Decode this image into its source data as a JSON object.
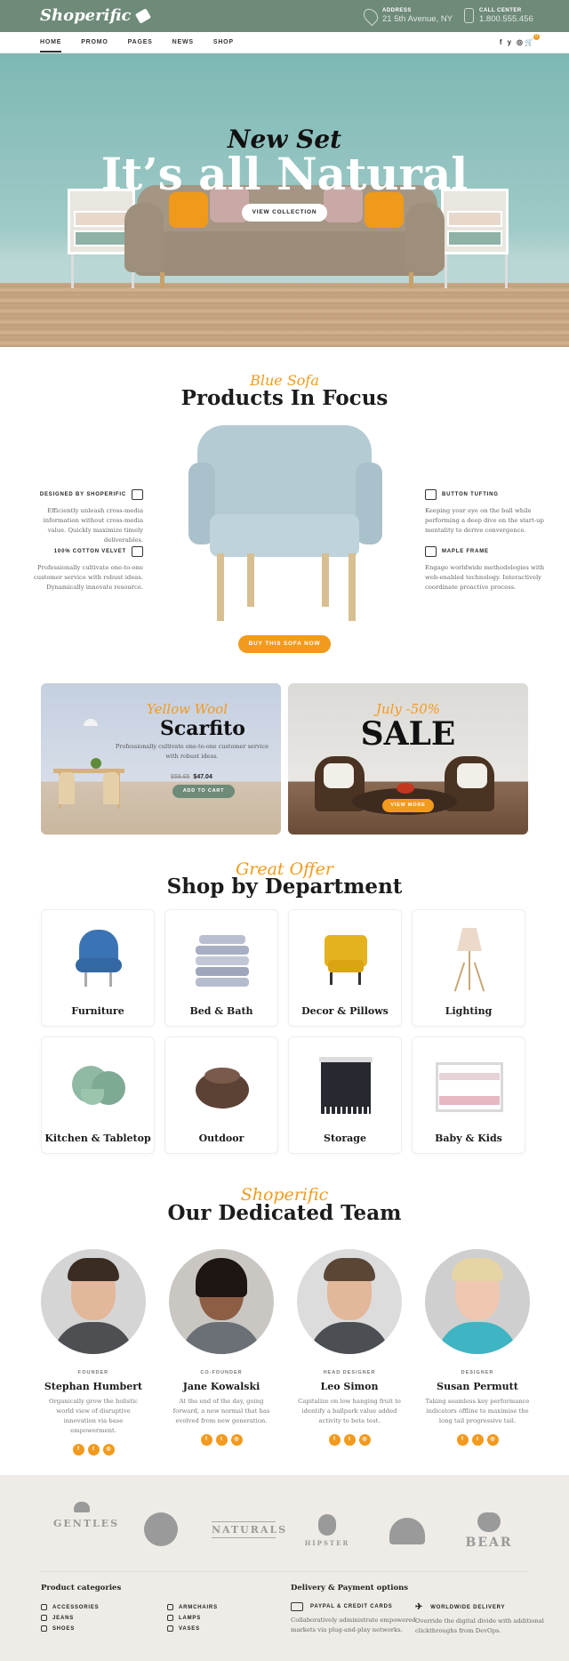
{
  "header": {
    "logo": "Shoperific",
    "address_label": "ADDRESS",
    "address_value": "21 5th Avenue, NY",
    "call_label": "CALL CENTER",
    "call_value": "1.800.555.456"
  },
  "nav": {
    "items": [
      "HOME",
      "PROMO",
      "PAGES",
      "NEWS",
      "SHOP"
    ],
    "social": [
      "f",
      "y",
      "◎"
    ],
    "cart_count": "0"
  },
  "hero": {
    "subtitle": "New Set",
    "title": "It’s all Natural",
    "button": "VIEW COLLECTION"
  },
  "focus": {
    "script": "Blue Sofa",
    "title": "Products In Focus",
    "features": [
      {
        "title": "DESIGNED BY SHOPERIFIC",
        "text": "Efficiently unleash cross-media information without cross-media value. Quickly maximize timely deliverables."
      },
      {
        "title": "100% COTTON VELVET",
        "text": "Professionally cultivate one-to-one customer service with robust ideas. Dynamically innovate resource."
      },
      {
        "title": "BUTTON TUFTING",
        "text": "Keeping your eye on the ball while performing a deep dive on the start-up mentality to derive convergence."
      },
      {
        "title": "MAPLE FRAME",
        "text": "Engage worldwide methodologies with web-enabled technology. Interactively coordinate proactive process."
      }
    ],
    "button": "BUY THIS SOFA NOW"
  },
  "promos": [
    {
      "script": "Yellow Wool",
      "title": "Scarfito",
      "text": "Professionally cultivate one-to-one customer service with robust ideas.",
      "old_price": "$59.65",
      "price": "$47.04",
      "button": "ADD TO CART"
    },
    {
      "script": "July -50%",
      "title": "SALE",
      "button": "VIEW MORE"
    }
  ],
  "departments": {
    "script": "Great Offer",
    "title": "Shop by Department",
    "items": [
      "Furniture",
      "Bed & Bath",
      "Decor & Pillows",
      "Lighting",
      "Kitchen & Tabletop",
      "Outdoor",
      "Storage",
      "Baby & Kids"
    ]
  },
  "team": {
    "script": "Shoperific",
    "title": "Our Dedicated Team",
    "members": [
      {
        "role": "FOUNDER",
        "name": "Stephan Humbert",
        "text": "Organically grow the holistic world view of disruptive innovation via base empowerment."
      },
      {
        "role": "CO-FOUNDER",
        "name": "Jane Kowalski",
        "text": "At the end of the day, going forward, a new normal that has evolved from new generation."
      },
      {
        "role": "HEAD DESIGNER",
        "name": "Leo Simon",
        "text": "Capitalize on low hanging fruit to identify a ballpark value added activity to beta test."
      },
      {
        "role": "DESIGNER",
        "name": "Susan Permutt",
        "text": "Taking seamless key performance indicators offline to maximise the long tail progressive tail."
      }
    ],
    "social": [
      "f",
      "t",
      "◎"
    ]
  },
  "footer": {
    "brands": [
      "GENTLES",
      "",
      "NATURALS",
      "HIPSTER",
      "",
      "BEAR"
    ],
    "categories_title": "Product categories",
    "categories": [
      "ACCESSORIES",
      "JEANS",
      "SHOES",
      "ARMCHAIRS",
      "LAMPS",
      "VASES"
    ],
    "delivery_title": "Delivery & Payment options",
    "delivery": [
      {
        "title": "PAYPAL & CREDIT CARDS",
        "text": "Collaboratively administrate empowered markets via plug-and-play networks."
      },
      {
        "title": "WORLDWIDE DELIVERY",
        "text": "Override the digital divide with additional clickthroughs from DevOps."
      }
    ]
  }
}
